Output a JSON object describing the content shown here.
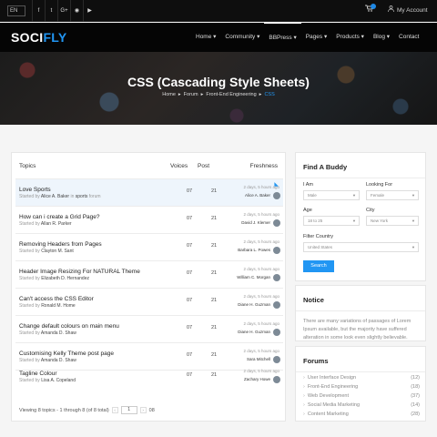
{
  "topbar": {
    "language": "EN",
    "social_icons": [
      "facebook-icon",
      "twitter-icon",
      "google-plus-icon",
      "rss-icon",
      "youtube-icon"
    ],
    "account_label": "My Account"
  },
  "header": {
    "logo_part1": "SOCI",
    "logo_part2": "FLY",
    "nav": [
      {
        "label": "Home ▾"
      },
      {
        "label": "Community ▾"
      },
      {
        "label": "BBPress ▾"
      },
      {
        "label": "Pages ▾"
      },
      {
        "label": "Products ▾"
      },
      {
        "label": "Blog ▾"
      },
      {
        "label": "Contact"
      }
    ],
    "active_nav": "BBPress"
  },
  "hero": {
    "title": "CSS (Cascading Style Sheets)",
    "breadcrumbs": [
      "Home",
      "Forum",
      "Front-End Engineering",
      "CSS"
    ]
  },
  "topics": {
    "headers": {
      "topics": "Topics",
      "voices": "Voices",
      "post": "Post",
      "freshness": "Freshness"
    },
    "rows": [
      {
        "title": "Love Sports",
        "started_by": "Started by",
        "author": "Alice A. Baker",
        "in_label": "in",
        "forum": "sports",
        "forum_suffix": "forum",
        "voices": "07",
        "posts": "21",
        "age": "2 days, 5 hours ago",
        "last_user": "Alice A. Baker"
      },
      {
        "title": "How can i create a Grid Page?",
        "started_by": "Started by",
        "author": "Allan R. Parker",
        "voices": "07",
        "posts": "21",
        "age": "2 days, 5 hours ago",
        "last_user": "David J. Klemer"
      },
      {
        "title": "Removing Headers from Pages",
        "started_by": "Started by",
        "author": "Clayton M. Sant",
        "voices": "07",
        "posts": "21",
        "age": "2 days, 5 hours ago",
        "last_user": "Barbara L. Powes"
      },
      {
        "title": "Header Image Resizing For NATURAL Theme",
        "started_by": "Started by",
        "author": "Elizabeth D. Hernandez",
        "voices": "07",
        "posts": "21",
        "age": "2 days, 5 hours ago",
        "last_user": "William C. Morgan"
      },
      {
        "title": "Can't access the CSS Editor",
        "started_by": "Started by",
        "author": "Ronald M. Home",
        "voices": "07",
        "posts": "21",
        "age": "2 days, 5 hours ago",
        "last_user": "Diane H. Guzman"
      },
      {
        "title": "Change default colours on main menu",
        "started_by": "Started by",
        "author": "Amanda D. Shaw",
        "voices": "07",
        "posts": "21",
        "age": "2 days, 5 hours ago",
        "last_user": "Diane H. Guzman"
      },
      {
        "title": "Customising Kelly Theme post page",
        "started_by": "Started by",
        "author": "Amanda D. Shaw",
        "voices": "07",
        "posts": "21",
        "age": "2 days, 5 hours ago",
        "last_user": "Sara Mitchell"
      },
      {
        "title": "Tagline Colour",
        "started_by": "Started by",
        "author": "Lisa A. Copeland",
        "voices": "07",
        "posts": "21",
        "age": "2 days, 5 hours ago",
        "last_user": "Zachary Howe"
      }
    ],
    "pager_text": "Viewing 8 topics - 1 through 8 (of 8 total)",
    "pager_page": "1",
    "pager_total": "08"
  },
  "find_buddy": {
    "title": "Find A Buddy",
    "i_am_label": "I Am",
    "i_am_value": "Male",
    "looking_for_label": "Looking For",
    "looking_for_value": "Female",
    "age_label": "Age",
    "age_value": "18 to 25",
    "city_label": "City",
    "city_value": "New York",
    "country_label": "Filter Country",
    "country_value": "United States",
    "search_label": "Search"
  },
  "notice": {
    "title": "Notice",
    "text": "There are many variations of passages of Lorem Ipsum available, but the majority have suffered alteration in some look even slightly believable."
  },
  "forums": {
    "title": "Forums",
    "items": [
      {
        "label": "User Interface Design",
        "count": "(12)"
      },
      {
        "label": "Front-End Engineering",
        "count": "(18)"
      },
      {
        "label": "Web Development",
        "count": "(37)"
      },
      {
        "label": "Social Media Marketing",
        "count": "(14)"
      },
      {
        "label": "Content Marketing",
        "count": "(28)"
      }
    ]
  },
  "colors": {
    "accent": "#2196f3",
    "header_bg": "#050505",
    "highlight_row": "#eef5fc"
  }
}
